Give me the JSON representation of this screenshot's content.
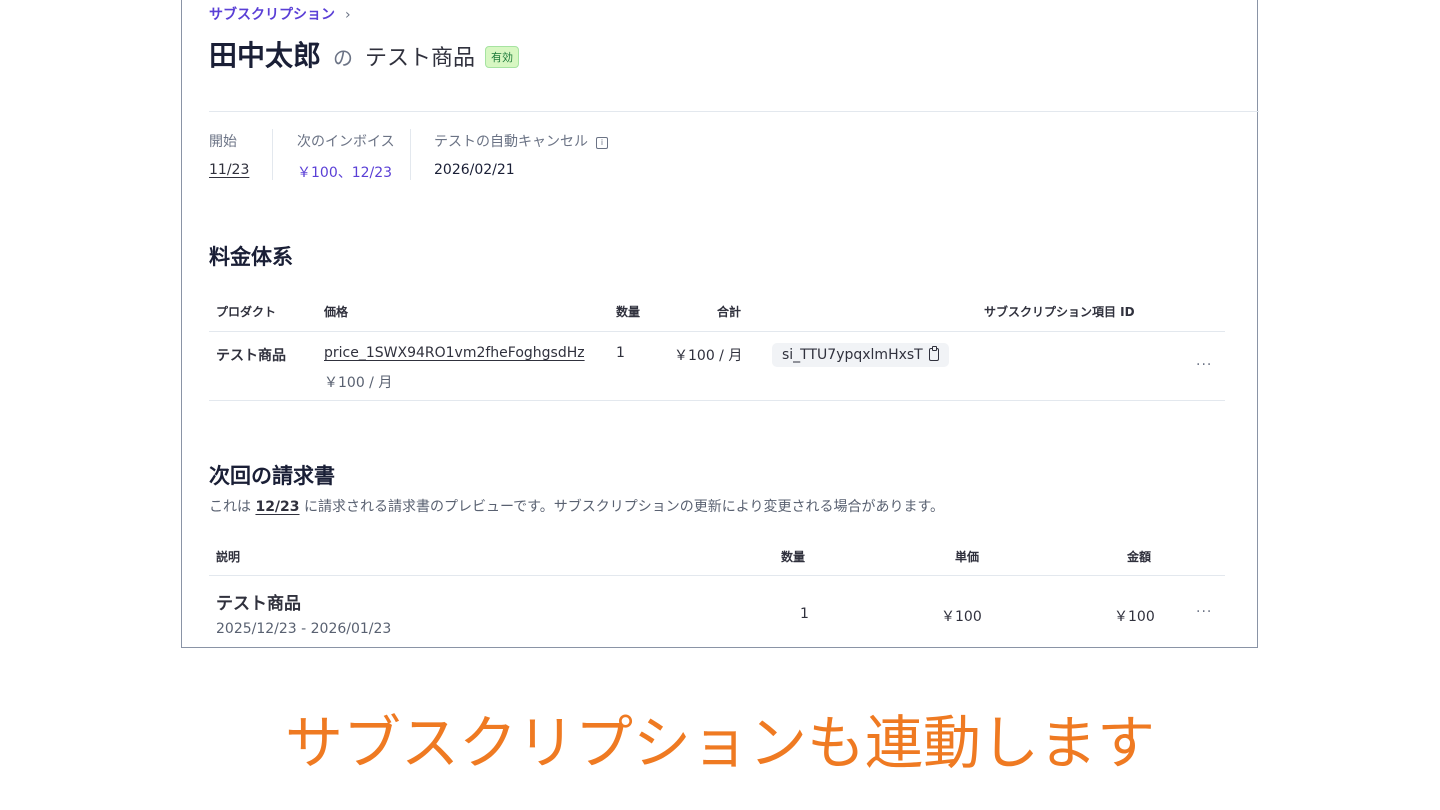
{
  "header": {
    "breadcrumb": "サブスクリプション",
    "breadcrumb_chevron": "›",
    "customer_name": "田中太郎",
    "connector": "の",
    "product_name": "テスト商品",
    "status_badge": "有効"
  },
  "meta": {
    "start_label": "開始",
    "start_value": "11/23",
    "next_invoice_label": "次のインボイス",
    "next_invoice_value": "￥100、12/23",
    "test_cancel_label": "テストの自動キャンセル",
    "test_cancel_value": "2026/02/21",
    "info_icon": "info-icon"
  },
  "pricing": {
    "title": "料金体系",
    "columns": {
      "product": "プロダクト",
      "price": "価格",
      "quantity": "数量",
      "total": "合計",
      "item_id": "サブスクリプション項目 ID"
    },
    "row": {
      "product": "テスト商品",
      "price_id": "price_1SWX94RO1vm2fheFoghgsdHz",
      "price_amount": "￥100 / 月",
      "quantity": "1",
      "total": "￥100 / 月",
      "item_id": "si_TTU7ypqxlmHxsT",
      "more": "···"
    }
  },
  "upcoming": {
    "title": "次回の請求書",
    "desc_prefix": "これは ",
    "desc_date": "12/23",
    "desc_suffix": " に請求される請求書のプレビューです。サブスクリプションの更新により変更される場合があります。",
    "columns": {
      "description": "説明",
      "quantity": "数量",
      "unit_price": "単価",
      "amount": "金額"
    },
    "row": {
      "description": "テスト商品",
      "period": "2025/12/23 - 2026/01/23",
      "quantity": "1",
      "unit_price": "￥100",
      "amount": "￥100",
      "more": "···"
    }
  },
  "caption": "サブスクリプションも連動します",
  "colors": {
    "accent": "#5a3fd6",
    "caption": "#ef7a22",
    "badge_bg": "#d7f7c2",
    "badge_text": "#1d7a3a"
  }
}
